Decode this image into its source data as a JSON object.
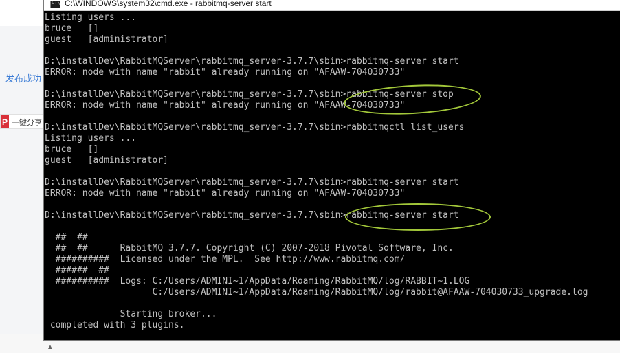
{
  "background": {
    "publish_text": "发布成功",
    "share_badge": "P",
    "share_text": "一键分享",
    "chevron_icon": "chevron-down-icon"
  },
  "window": {
    "title": "C:\\WINDOWS\\system32\\cmd.exe - rabbitmq-server  start",
    "icon": "console-icon"
  },
  "console_lines": [
    {
      "indent": 0,
      "text": "Listing users ..."
    },
    {
      "indent": 0,
      "text": "bruce   []"
    },
    {
      "indent": 0,
      "text": "guest   [administrator]"
    },
    {
      "indent": 0,
      "text": ""
    },
    {
      "indent": 0,
      "text": "D:\\installDev\\RabbitMQServer\\rabbitmq_server-3.7.7\\sbin>rabbitmq-server start"
    },
    {
      "indent": 0,
      "text": "ERROR: node with name \"rabbit\" already running on \"AFAAW-704030733\""
    },
    {
      "indent": 0,
      "text": ""
    },
    {
      "indent": 0,
      "text": "D:\\installDev\\RabbitMQServer\\rabbitmq_server-3.7.7\\sbin>rabbitmq-server stop"
    },
    {
      "indent": 0,
      "text": "ERROR: node with name \"rabbit\" already running on \"AFAAW-704030733\""
    },
    {
      "indent": 0,
      "text": ""
    },
    {
      "indent": 0,
      "text": "D:\\installDev\\RabbitMQServer\\rabbitmq_server-3.7.7\\sbin>rabbitmqctl list_users"
    },
    {
      "indent": 0,
      "text": "Listing users ..."
    },
    {
      "indent": 0,
      "text": "bruce   []"
    },
    {
      "indent": 0,
      "text": "guest   [administrator]"
    },
    {
      "indent": 0,
      "text": ""
    },
    {
      "indent": 0,
      "text": "D:\\installDev\\RabbitMQServer\\rabbitmq_server-3.7.7\\sbin>rabbitmq-server start"
    },
    {
      "indent": 0,
      "text": "ERROR: node with name \"rabbit\" already running on \"AFAAW-704030733\""
    },
    {
      "indent": 0,
      "text": ""
    },
    {
      "indent": 0,
      "text": "D:\\installDev\\RabbitMQServer\\rabbitmq_server-3.7.7\\sbin>rabbitmq-server start"
    },
    {
      "indent": 0,
      "text": ""
    },
    {
      "indent": 0,
      "text": "  ##  ##"
    },
    {
      "indent": 0,
      "text": "  ##  ##      RabbitMQ 3.7.7. Copyright (C) 2007-2018 Pivotal Software, Inc."
    },
    {
      "indent": 0,
      "text": "  ##########  Licensed under the MPL.  See http://www.rabbitmq.com/"
    },
    {
      "indent": 0,
      "text": "  ######  ##"
    },
    {
      "indent": 0,
      "text": "  ##########  Logs: C:/Users/ADMINI~1/AppData/Roaming/RabbitMQ/log/RABBIT~1.LOG"
    },
    {
      "indent": 0,
      "text": "                    C:/Users/ADMINI~1/AppData/Roaming/RabbitMQ/log/rabbit@AFAAW-704030733_upgrade.log"
    },
    {
      "indent": 0,
      "text": ""
    },
    {
      "indent": 0,
      "text": "              Starting broker..."
    },
    {
      "indent": 0,
      "text": " completed with 3 plugins."
    }
  ],
  "colors": {
    "console_bg": "#000000",
    "console_text": "#c0c0c0",
    "highlight": "#a3c83a"
  }
}
